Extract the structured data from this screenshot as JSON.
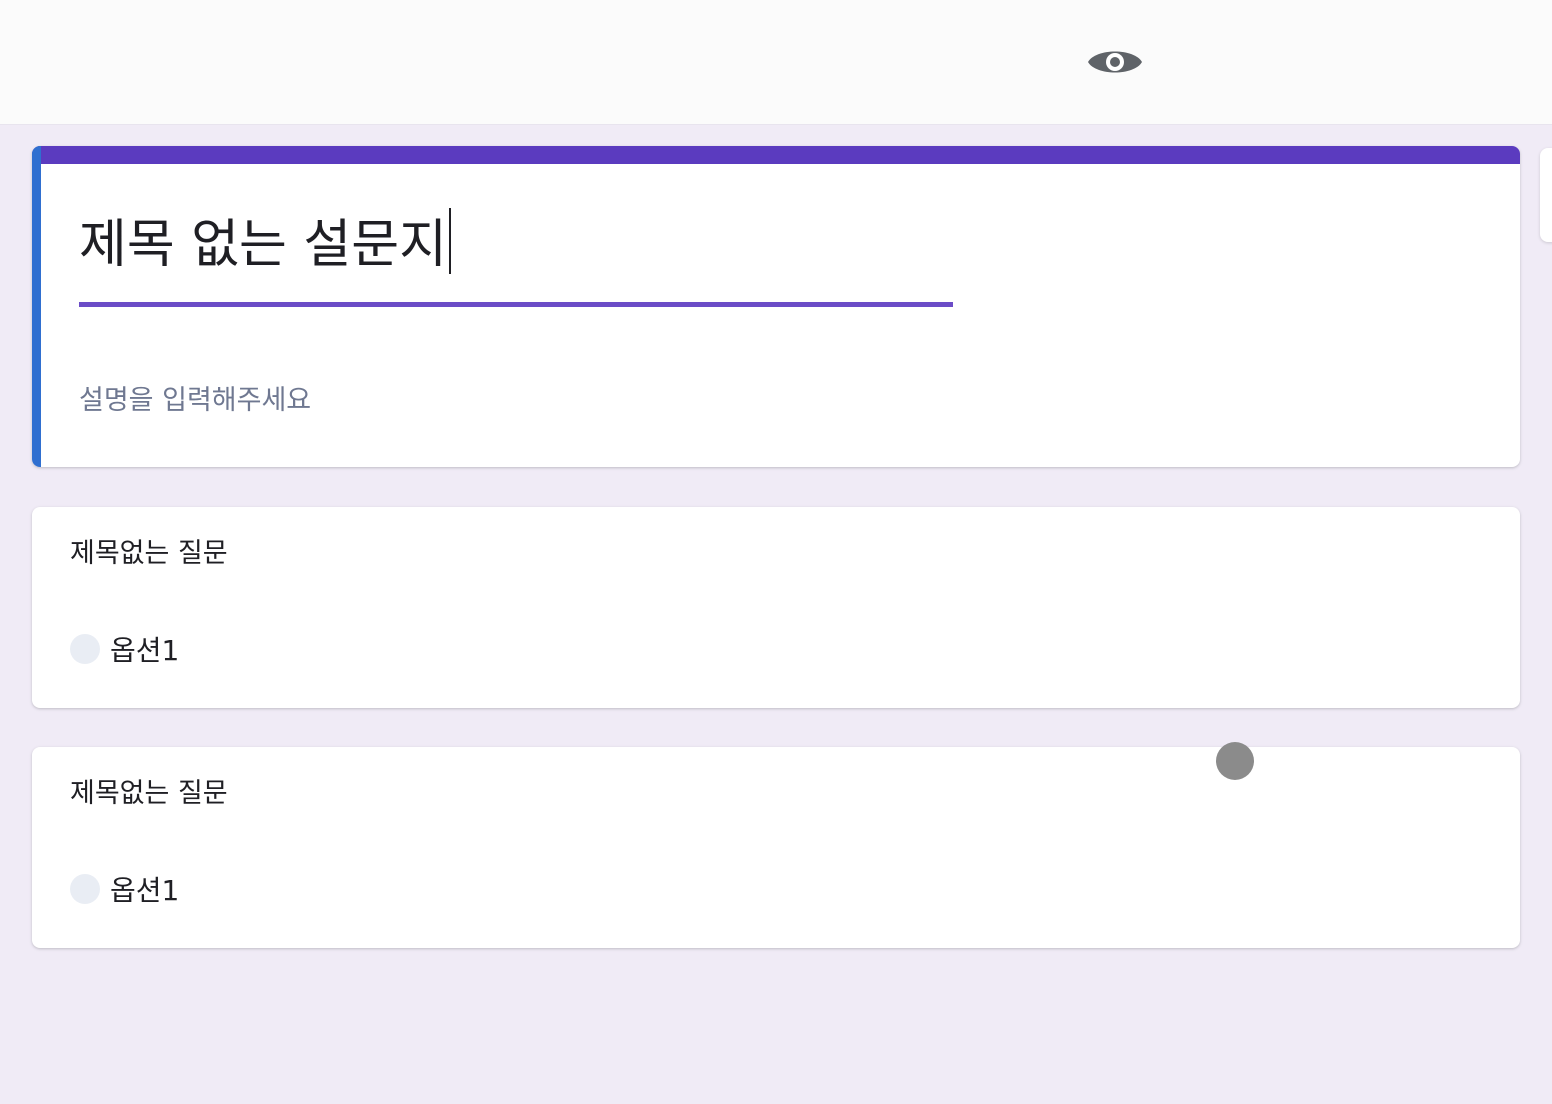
{
  "toolbar": {
    "preview_icon": "eye-icon"
  },
  "form": {
    "title": "제목 없는 설문지",
    "description_placeholder": "설명을 입력해주세요",
    "accent_color": "#5b3bbf",
    "side_accent_color": "#2f6fd0"
  },
  "questions": [
    {
      "title": "제목없는 질문",
      "options": [
        {
          "label": "옵션1"
        }
      ]
    },
    {
      "title": "제목없는 질문",
      "options": [
        {
          "label": "옵션1"
        }
      ]
    }
  ]
}
